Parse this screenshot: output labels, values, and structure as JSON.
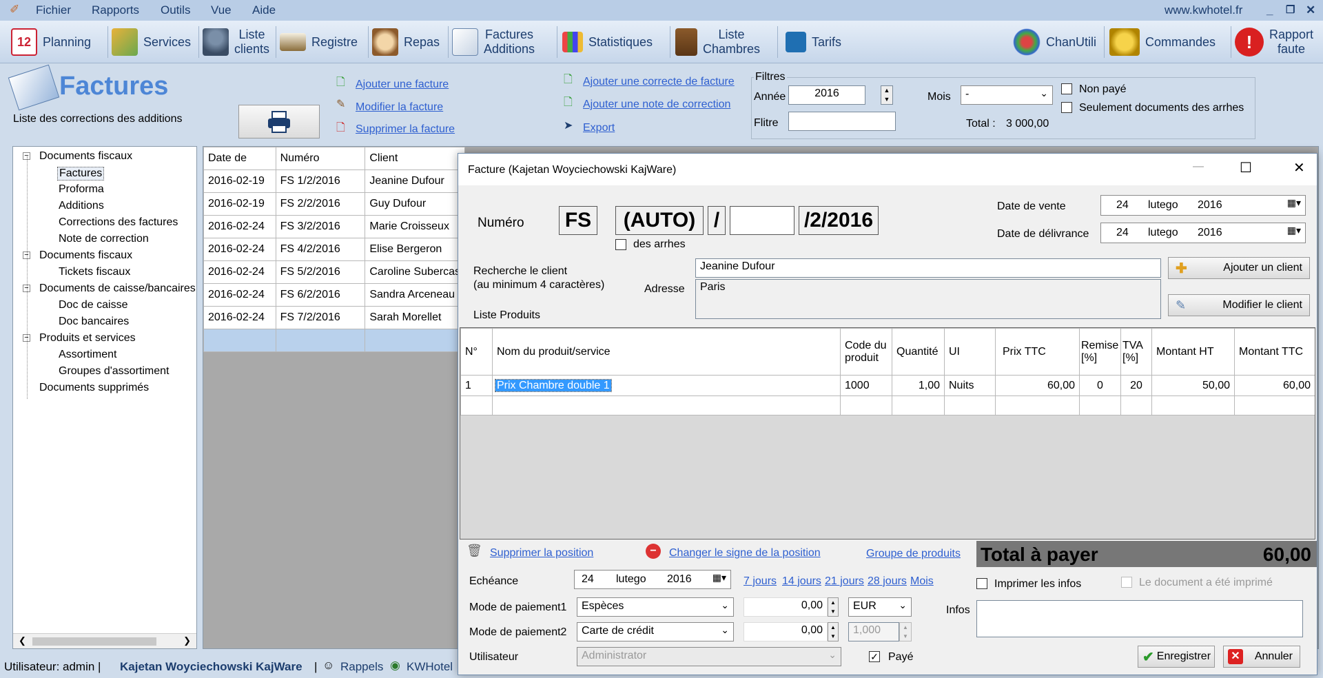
{
  "menu": {
    "items": [
      "Fichier",
      "Rapports",
      "Outils",
      "Vue",
      "Aide"
    ],
    "site": "www.kwhotel.fr"
  },
  "toolbar": {
    "planning": "Planning",
    "services": "Services",
    "liste_clients_1": "Liste",
    "liste_clients_2": "clients",
    "registre": "Registre",
    "repas": "Repas",
    "factures_1": "Factures",
    "factures_2": "Additions",
    "statistiques": "Statistiques",
    "liste_chambres_1": "Liste",
    "liste_chambres_2": "Chambres",
    "tarifs": "Tarifs",
    "chanutili": "ChanUtili",
    "commandes": "Commandes",
    "rapport_1": "Rapport",
    "rapport_2": "faute"
  },
  "page": {
    "title": "Factures",
    "subtitle": "Liste des corrections des additions"
  },
  "actions": {
    "ajouter": "Ajouter une facture",
    "modifier": "Modifier la facture",
    "supprimer": "Supprimer la facture",
    "correcte": "Ajouter une correcte de facture",
    "note": "Ajouter une note de correction",
    "export": "Export"
  },
  "filters": {
    "legend": "Filtres",
    "annee_label": "Année",
    "annee_value": "2016",
    "mois_label": "Mois",
    "mois_value": "-",
    "filtre_label": "Flitre",
    "filtre_value": "",
    "non_paye": "Non payé",
    "seulement": "Seulement documents des arrhes",
    "total_label": "Total :",
    "total_value": "3 000,00"
  },
  "tree": [
    {
      "label": "Documents fiscaux",
      "level": 0
    },
    {
      "label": "Factures",
      "level": 1
    },
    {
      "label": "Proforma",
      "level": 1
    },
    {
      "label": "Additions",
      "level": 1
    },
    {
      "label": "Corrections des factures",
      "level": 1
    },
    {
      "label": "Note de correction",
      "level": 1
    },
    {
      "label": "Documents fiscaux",
      "level": 0
    },
    {
      "label": "Tickets fiscaux",
      "level": 1
    },
    {
      "label": "Documents de caisse/bancaires",
      "level": 0
    },
    {
      "label": "Doc de caisse",
      "level": 1
    },
    {
      "label": "Doc bancaires",
      "level": 1
    },
    {
      "label": "Produits et services",
      "level": 0
    },
    {
      "label": "Assortiment",
      "level": 1
    },
    {
      "label": "Groupes d'assortiment",
      "level": 1
    },
    {
      "label": "Documents supprimés",
      "level": 0
    }
  ],
  "invoices": {
    "headers": [
      "Date de",
      "Numéro",
      "Client"
    ],
    "rows": [
      [
        "2016-02-19",
        "FS 1/2/2016",
        "Jeanine Dufour"
      ],
      [
        "2016-02-19",
        "FS 2/2/2016",
        "Guy Dufour"
      ],
      [
        "2016-02-24",
        "FS 3/2/2016",
        "Marie Croisseux"
      ],
      [
        "2016-02-24",
        "FS 4/2/2016",
        "Elise Bergeron"
      ],
      [
        "2016-02-24",
        "FS 5/2/2016",
        "Caroline Subercas"
      ],
      [
        "2016-02-24",
        "FS 6/2/2016",
        "Sandra Arceneau"
      ],
      [
        "2016-02-24",
        "FS 7/2/2016",
        "Sarah Morellet"
      ]
    ]
  },
  "status": {
    "user": "Utilisateur: admin |",
    "company": "Kajetan Woyciechowski KajWare",
    "sep": "|",
    "rappels": "Rappels",
    "kwhotel": "KWHotel"
  },
  "dialog": {
    "title": "Facture   (Kajetan Woyciechowski KajWare)",
    "numero_label": "Numéro",
    "prefix": "FS",
    "auto": "(AUTO)",
    "slash": "/",
    "suffix": "/2/2016",
    "des_arrhes": "des arrhes",
    "date_vente_label": "Date de vente",
    "date_delivrance_label": "Date de délivrance",
    "date_day": "24",
    "date_month": "lutego",
    "date_year": "2016",
    "recherche_1": "Recherche le client",
    "recherche_2": "(au minimum 4 caractères)",
    "client_value": "Jeanine Dufour",
    "adresse_label": "Adresse",
    "adresse_value": "Paris",
    "ajouter_client": "Ajouter un client",
    "modifier_client": "Modifier le client",
    "liste_produits": "Liste Produits",
    "products": {
      "headers": [
        "N°",
        "Nom du produit/service",
        "Code du produit",
        "Quantité",
        "UI",
        "Prix TTC",
        "Remise [%]",
        "TVA [%]",
        "Montant HT",
        "Montant TTC"
      ],
      "rows": [
        [
          "1",
          "Prix Chambre double 1",
          "1000",
          "1,00",
          "Nuits",
          "60,00",
          "0",
          "20",
          "50,00",
          "60,00"
        ]
      ]
    },
    "supprimer_position": "Supprimer la position",
    "changer_signe": "Changer le signe de la position",
    "groupe_produits": "Groupe de produits",
    "total_label": "Total à payer",
    "total_value": "60,00",
    "echeance_label": "Echéance",
    "quick": [
      "7 jours",
      "14 jours",
      "21 jours",
      "28 jours",
      "Mois"
    ],
    "imprimer_infos": "Imprimer les infos",
    "document_imprime": "Le document a été imprimé",
    "mode1_label": "Mode de paiement1",
    "mode1_value": "Espèces",
    "mode1_amount": "0,00",
    "currency": "EUR",
    "mode2_label": "Mode de paiement2",
    "mode2_value": "Carte de crédit",
    "mode2_amount": "0,00",
    "rate": "1,000",
    "infos_label": "Infos",
    "utilisateur_label": "Utilisateur",
    "utilisateur_value": "Administrator",
    "paye": "Payé",
    "enregistrer": "Enregistrer",
    "annuler": "Annuler"
  }
}
